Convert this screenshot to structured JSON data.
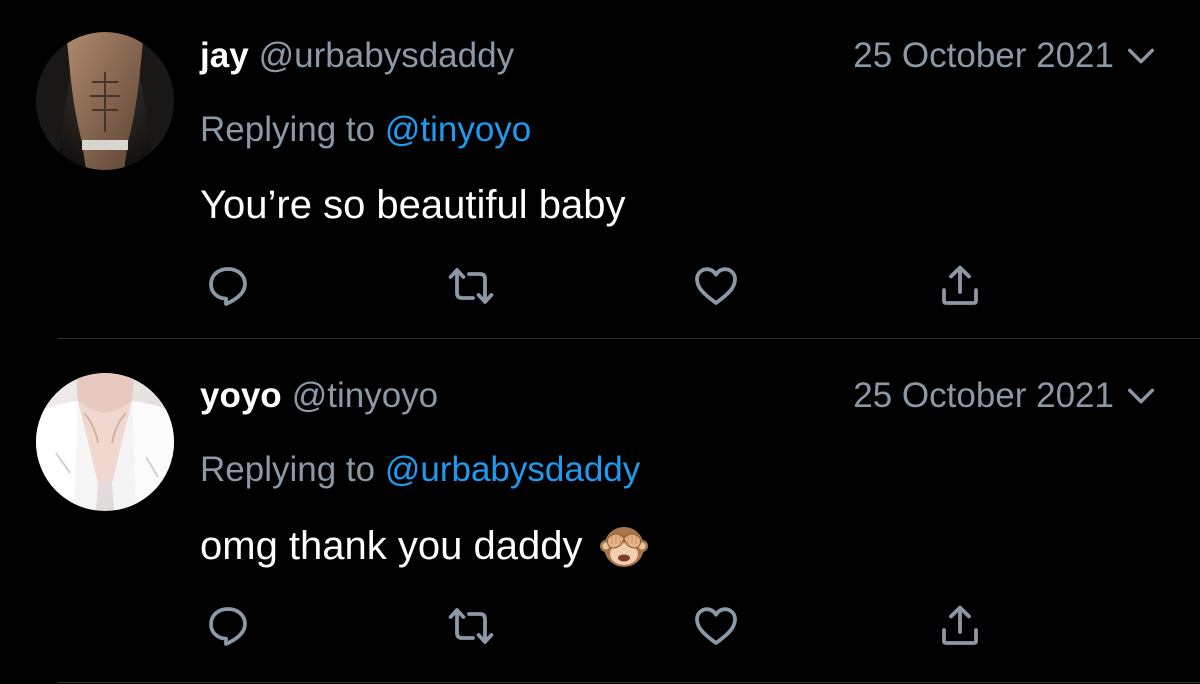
{
  "tweets": [
    {
      "display_name": "jay",
      "handle": "@urbabysdaddy",
      "date": "25 October 2021",
      "replying_prefix": "Replying to",
      "replying_to": "@tinyoyo",
      "text": "You’re so beautiful baby",
      "emoji": ""
    },
    {
      "display_name": "yoyo",
      "handle": "@tinyoyo",
      "date": "25 October 2021",
      "replying_prefix": "Replying to",
      "replying_to": "@urbabysdaddy",
      "text": "omg thank you daddy",
      "emoji": "see-no-evil-monkey"
    }
  ],
  "icons": {
    "reply": "reply-icon",
    "retweet": "retweet-icon",
    "like": "heart-icon",
    "share": "share-icon",
    "more": "chevron-down-icon"
  },
  "colors": {
    "background": "#000000",
    "primary_text": "#ffffff",
    "secondary_text": "#8b98a5",
    "mention": "#1d9bf0",
    "divider": "#2f3336"
  }
}
